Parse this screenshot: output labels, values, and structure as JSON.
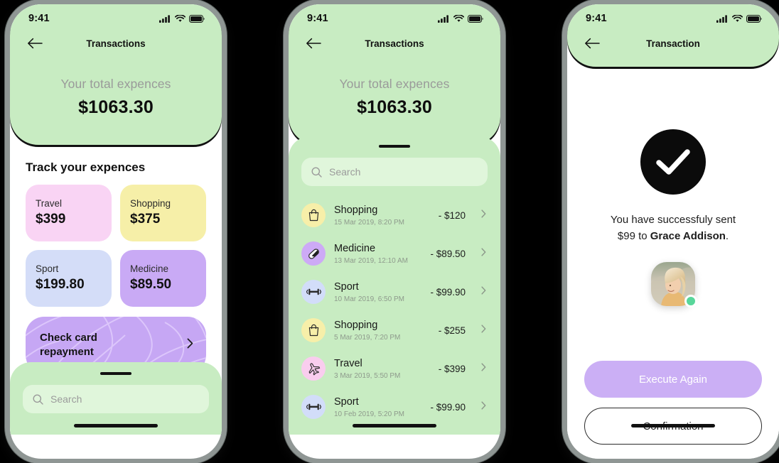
{
  "status_bar": {
    "time": "9:41",
    "signal_icon": "signal-bars-icon",
    "wifi_icon": "wifi-icon",
    "battery_icon": "battery-icon"
  },
  "colors": {
    "green": "#c8ecc2",
    "green_light": "#e0f6db",
    "purple": "#c6a7f4",
    "purple_button": "#cbaff5",
    "pink": "#f9d4f4",
    "yellow": "#f6efa8",
    "blue": "#d4ddf8",
    "violet": "#c9aaf5",
    "status_dot": "#58d69a"
  },
  "screen1": {
    "nav_title": "Transactions",
    "back_icon": "back-arrow-icon",
    "total_label": "Your total expences",
    "total_value": "$1063.30",
    "section_title": "Track your expences",
    "categories": [
      {
        "name": "Travel",
        "amount": "$399",
        "color": "#f9d4f4"
      },
      {
        "name": "Shopping",
        "amount": "$375",
        "color": "#f6efa8"
      },
      {
        "name": "Sport",
        "amount": "$199.80",
        "color": "#d4ddf8"
      },
      {
        "name": "Medicine",
        "amount": "$89.50",
        "color": "#c9aaf5"
      }
    ],
    "repayment": {
      "line1": "Check card",
      "line2": "repayment",
      "chevron_icon": "chevron-right-icon"
    },
    "search": {
      "placeholder": "Search",
      "icon": "search-icon"
    }
  },
  "screen2": {
    "nav_title": "Transactions",
    "back_icon": "back-arrow-icon",
    "total_label": "Your total expences",
    "total_value": "$1063.30",
    "search": {
      "placeholder": "Search",
      "icon": "search-icon"
    },
    "transactions": [
      {
        "name": "Shopping",
        "date": "15 Mar 2019, 8:20 PM",
        "amount": "- $120",
        "icon": "shopping-bag-icon",
        "icon_bg": "#f7efa9"
      },
      {
        "name": "Medicine",
        "date": "13 Mar 2019, 12:10 AM",
        "amount": "- $89.50",
        "icon": "pill-icon",
        "icon_bg": "#cdaaf6"
      },
      {
        "name": "Sport",
        "date": "10 Mar 2019, 6:50 PM",
        "amount": "- $99.90",
        "icon": "dumbbell-icon",
        "icon_bg": "#d2ddf9"
      },
      {
        "name": "Shopping",
        "date": "5 Mar 2019, 7:20 PM",
        "amount": "- $255",
        "icon": "shopping-bag-icon",
        "icon_bg": "#f7efa9"
      },
      {
        "name": "Travel",
        "date": "3 Mar 2019, 5:50 PM",
        "amount": "- $399",
        "icon": "airplane-icon",
        "icon_bg": "#f9cdee"
      },
      {
        "name": "Sport",
        "date": "10 Feb 2019, 5:20 PM",
        "amount": "- $99.90",
        "icon": "dumbbell-icon",
        "icon_bg": "#d2ddf9"
      }
    ]
  },
  "screen3": {
    "nav_title": "Transaction",
    "back_icon": "back-arrow-icon",
    "success_icon": "checkmark-circle-icon",
    "message_line1": "You have successfuly sent",
    "message_prefix": "$99 to ",
    "recipient": "Grace Addison",
    "message_suffix": ".",
    "avatar_name": "recipient-avatar",
    "primary_button": "Execute Again",
    "secondary_button": "Confirmation"
  }
}
